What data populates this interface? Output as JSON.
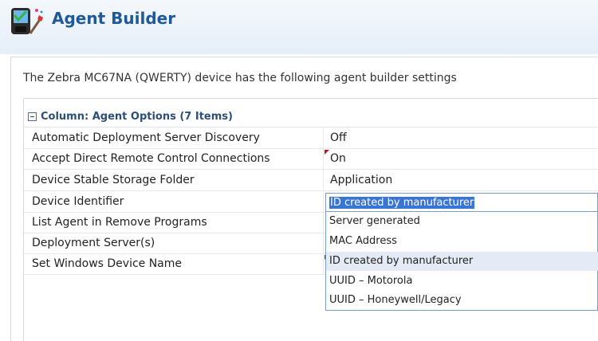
{
  "app": {
    "title": "Agent Builder",
    "icon": "agent-builder-icon"
  },
  "intro": "The Zebra MC67NA (QWERTY) device has the following agent builder settings",
  "column_group": {
    "title": "Column: Agent Options (7 Items)",
    "icon": "collapse-minus-icon"
  },
  "rows": [
    {
      "label": "Automatic Deployment Server Discovery",
      "value": "Off"
    },
    {
      "label": "Accept Direct Remote Control Connections",
      "value": "On"
    },
    {
      "label": "Device Stable Storage Folder",
      "value": "Application"
    },
    {
      "label": "Device Identifier",
      "value": "ID created by manufacturer"
    },
    {
      "label": "List Agent in Remove Programs",
      "value": ""
    },
    {
      "label": "Deployment Server(s)",
      "value": ""
    },
    {
      "label": "Set Windows Device Name",
      "value": ""
    }
  ],
  "device_identifier_select": {
    "selected": "ID created by manufacturer",
    "options": [
      "Server generated",
      "MAC Address",
      "ID created by manufacturer",
      "UUID – Motorola",
      "UUID – Honeywell/Legacy"
    ]
  },
  "colors": {
    "title": "#1f5a96",
    "selection": "#3875d7",
    "highlight_row": "#e4ebf6",
    "change_flag": "#c0132a"
  }
}
